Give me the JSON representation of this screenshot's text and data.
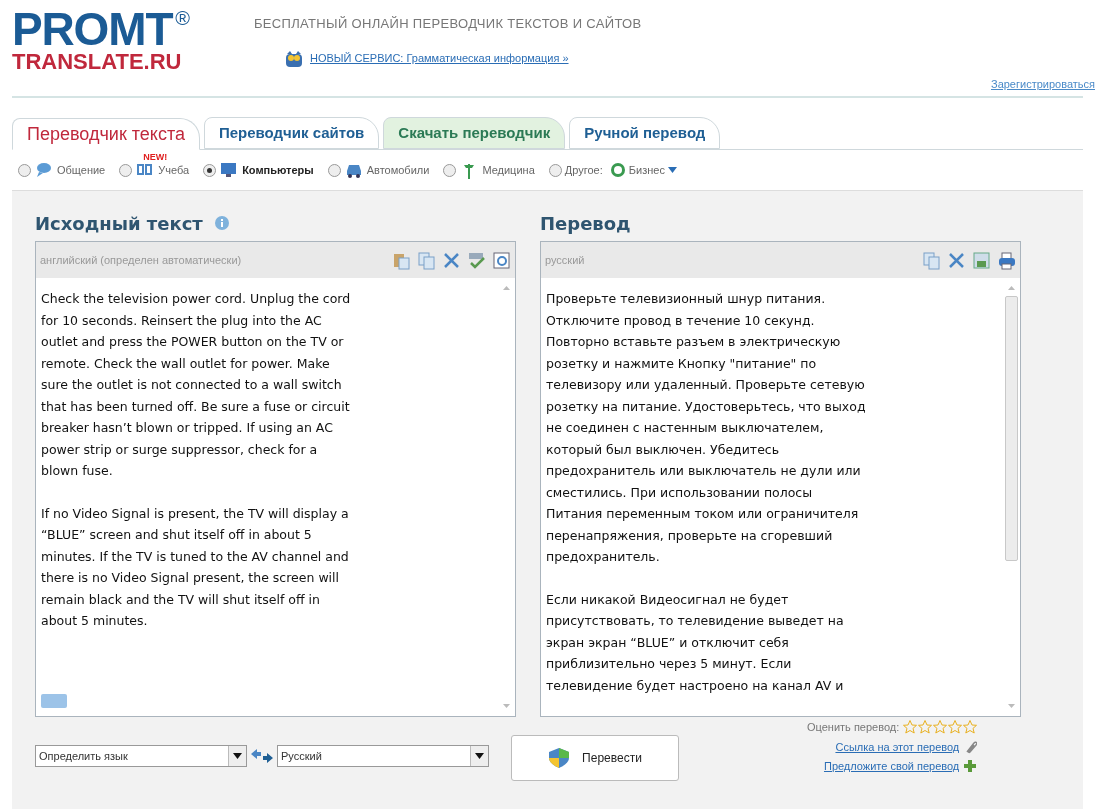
{
  "header": {
    "logo_title": "PROMT",
    "logo_mark": "®",
    "logo_subtitle": "TRANSLATE.RU",
    "tagline": "БЕСПЛАТНЫЙ ОНЛАЙН ПЕРЕВОДЧИК ТЕКСТОВ И САЙТОВ",
    "news_link": "НОВЫЙ СЕРВИС: Грамматическая информация »",
    "register_link": "Зарегистрироваться"
  },
  "tabs": [
    {
      "label": "Переводчик текста",
      "selected": true,
      "kind": "plain"
    },
    {
      "label": "Переводчик сайтов",
      "selected": false,
      "kind": "plain"
    },
    {
      "label": "Скачать переводчик",
      "selected": false,
      "kind": "highlighted"
    },
    {
      "label": "Ручной перевод",
      "selected": false,
      "kind": "plain"
    }
  ],
  "topics": [
    {
      "label": "Общение",
      "selected": false
    },
    {
      "label": "Учеба",
      "selected": false,
      "badge": "NEW!"
    },
    {
      "label": "Компьютеры",
      "selected": true
    },
    {
      "label": "Автомобили",
      "selected": false
    },
    {
      "label": "Медицина",
      "selected": false
    },
    {
      "label": "Другое:",
      "selected": false,
      "dropdown": "Бизнес"
    }
  ],
  "source": {
    "heading": "Исходный текст",
    "language": "английский (определен автоматически)",
    "paragraphs": [
      "Check the television power cord. Unplug the cord\nfor 10 seconds. Reinsert the plug into the AC\noutlet and press the POWER button on the TV or\nremote. Check the wall outlet for power. Make\nsure the outlet is not connected to a wall switch\nthat has been turned off. Be sure a fuse or circuit\nbreaker hasn’t blown or tripped. If using an AC\npower strip or surge suppressor, check for a\nblown fuse.",
      "If no Video Signal is present, the TV will display a\n“BLUE” screen and shut itself off in about 5\nminutes. If the TV is tuned to the AV channel and\nthere is no Video Signal present, the screen will\nremain black and the TV will shut itself off in\nabout 5 minutes."
    ]
  },
  "target": {
    "heading": "Перевод",
    "language": "русский",
    "paragraphs": [
      "Проверьте телевизионный шнур питания.\nОтключите провод в течение 10 секунд.\nПовторно вставьте разъем в электрическую\nрозетку и нажмите Кнопку \"питание\" по\nтелевизору или удаленный. Проверьте сетевую\nрозетку на питание. Удостоверьтесь, что выход\nне соединен с настенным выключателем,\nкоторый был выключен. Убедитесь\nпредохранитель или выключатель не дули или\nсместились. При использовании полосы\nПитания переменным током или ограничителя\nперенапряжения, проверьте на сгоревший\nпредохранитель.",
      "Если никакой Видеосигнал не будет\nприсутствовать, то телевидение выведет на\nэкран экран “BLUE” и отключит себя\nприблизительно через 5 минут. Если\nтелевидение будет настроено на канал AV и"
    ]
  },
  "controls": {
    "source_language": "Определить язык",
    "target_language": "Русский",
    "translate_button": "Перевести",
    "rating_label": "Оценить перевод:",
    "stars": 0,
    "links": [
      "Ссылка на этот перевод",
      "Предложите свой перевод"
    ]
  }
}
